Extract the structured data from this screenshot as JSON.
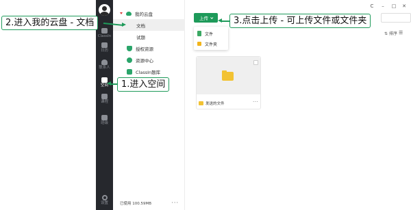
{
  "rail": {
    "items": [
      {
        "label": "ClassIn"
      },
      {
        "label": "日历"
      },
      {
        "label": "联系人"
      },
      {
        "label": "空间"
      },
      {
        "label": "课程"
      },
      {
        "label": "班级"
      },
      {
        "label": "设置"
      }
    ]
  },
  "tree": {
    "root_label": "我的云盘",
    "documents_label": "文档",
    "exams_label": "试题",
    "authorized_label": "授权资源",
    "resource_center_label": "资源中心",
    "question_bank_label": "ClassIn题库",
    "storage_used": "已使用 100.59MB",
    "more": "···"
  },
  "toolbar": {
    "upload_label": "上传",
    "sort_label": "排序",
    "list_icon": "☰"
  },
  "upload_menu": {
    "items": [
      {
        "label": "文件",
        "icon": "file-icon"
      },
      {
        "label": "文件夹",
        "icon": "folder-icon"
      }
    ]
  },
  "window_controls": {
    "refresh": "C",
    "minimize": "–",
    "maximize": "□",
    "close": "✕"
  },
  "files": [
    {
      "name": "发送的文件",
      "type": "folder",
      "more": "···"
    }
  ],
  "annotations": {
    "step1": "1.进入空间",
    "step2": "2.进入我的云盘 - 文档",
    "step3": "3.点击上传 - 可上传文件或文件夹"
  },
  "colors": {
    "accent": "#1e9a5a",
    "rail_bg": "#26282d",
    "folder": "#f2c233"
  }
}
